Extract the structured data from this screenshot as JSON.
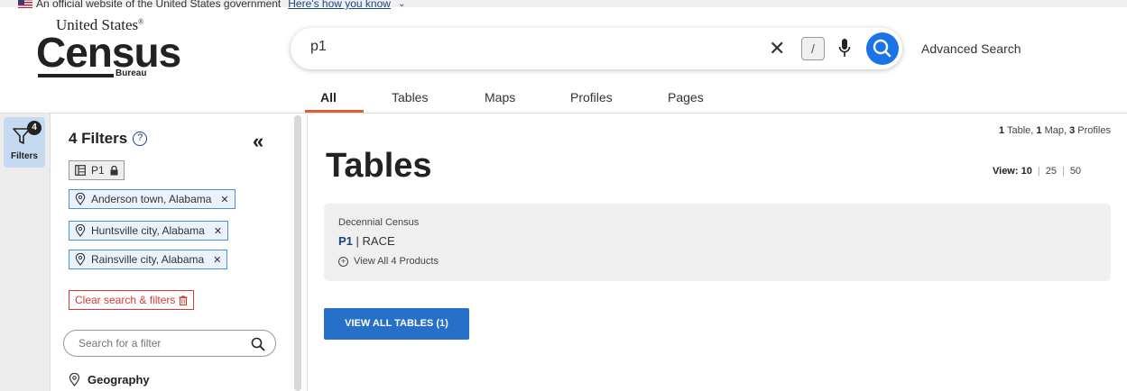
{
  "gov_banner": {
    "text": "An official website of the United States government",
    "link": "Here's how you know"
  },
  "logo": {
    "top": "United States",
    "main": "Census",
    "bottom": "Bureau"
  },
  "search": {
    "value": "p1",
    "slash_key": "/",
    "advanced_label": "Advanced Search"
  },
  "tabs": [
    "All",
    "Tables",
    "Maps",
    "Profiles",
    "Pages"
  ],
  "rail": {
    "label": "Filters",
    "badge": "4"
  },
  "filters": {
    "title": "4 Filters",
    "help": "?",
    "collapse": "«",
    "p1_chip": "P1",
    "geos": [
      "Anderson town, Alabama",
      "Huntsville city, Alabama",
      "Rainsville city, Alabama"
    ],
    "clear": "Clear search & filters",
    "search_placeholder": "Search for a filter",
    "section": "Geography"
  },
  "results": {
    "counts": {
      "tables_n": "1",
      "tables_label": " Table, ",
      "maps_n": "1",
      "maps_label": " Map, ",
      "profiles_n": "3",
      "profiles_label": " Profiles"
    },
    "heading": "Tables",
    "view_label": "View:",
    "view_opts": [
      "10",
      "25",
      "50"
    ],
    "card": {
      "source": "Decennial Census",
      "id": "P1",
      "title": "RACE",
      "more": "View All 4 Products"
    },
    "view_all": "VIEW ALL TABLES (1)"
  },
  "colors": {
    "accent": "#1a73e8",
    "tab_underline": "#e05a32",
    "button": "#2670c9",
    "danger": "#d83933"
  }
}
